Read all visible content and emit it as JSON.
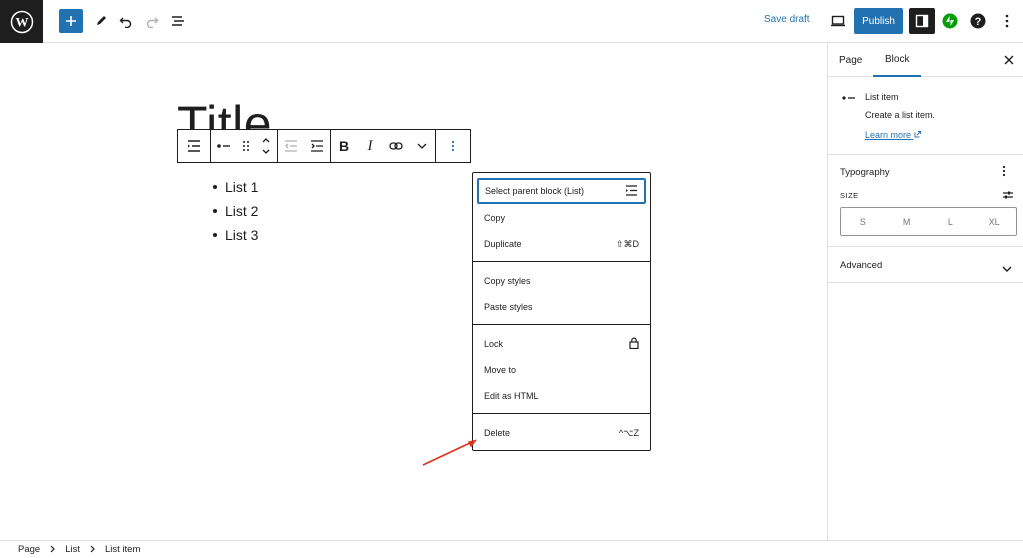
{
  "topbar": {
    "save_draft": "Save draft",
    "publish": "Publish"
  },
  "editor": {
    "title": "Title",
    "list_items": [
      "List 1",
      "List 2",
      "List 3"
    ]
  },
  "block_toolbar": {
    "bold": "B",
    "italic": "I"
  },
  "menu": {
    "items": [
      {
        "label": "Select parent block (List)",
        "shortcut": ""
      },
      {
        "label": "Copy",
        "shortcut": ""
      },
      {
        "label": "Duplicate",
        "shortcut": "⇧⌘D"
      },
      {
        "label": "Copy styles",
        "shortcut": ""
      },
      {
        "label": "Paste styles",
        "shortcut": ""
      },
      {
        "label": "Lock",
        "shortcut": ""
      },
      {
        "label": "Move to",
        "shortcut": ""
      },
      {
        "label": "Edit as HTML",
        "shortcut": ""
      },
      {
        "label": "Delete",
        "shortcut": "^⌥Z"
      }
    ]
  },
  "sidebar": {
    "tabs": [
      "Page",
      "Block"
    ],
    "active_tab": "Block",
    "block_card": {
      "title": "List item",
      "description": "Create a list item.",
      "learn_more": "Learn more"
    },
    "typography": {
      "title": "Typography",
      "size_label": "SIZE",
      "sizes": [
        "S",
        "M",
        "L",
        "XL"
      ]
    },
    "advanced": "Advanced"
  },
  "breadcrumb": [
    "Page",
    "List",
    "List item"
  ],
  "colors": {
    "accent": "#2271b1",
    "dark": "#1e1e1e",
    "arrow": "#e0321e",
    "jetpack": "#069e08"
  }
}
